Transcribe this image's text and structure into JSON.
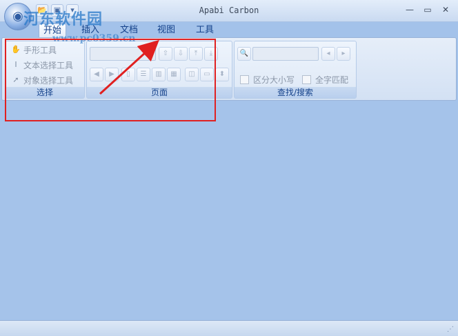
{
  "window": {
    "title": "Apabi Carbon",
    "orb_icon": "app-orb-icon",
    "qat": [
      {
        "icon": "folder-icon",
        "glyph": "📂"
      },
      {
        "icon": "save-icon",
        "glyph": "▣"
      },
      {
        "icon": "dropdown-icon",
        "glyph": "▾"
      }
    ],
    "controls": {
      "minimize": "—",
      "maximize": "▭",
      "close": "✕"
    }
  },
  "watermark": {
    "text": "河东软件园",
    "url": "www.pc0359.cn"
  },
  "tabs": [
    {
      "label": "开始",
      "active": true
    },
    {
      "label": "插入",
      "active": false
    },
    {
      "label": "文档",
      "active": false
    },
    {
      "label": "视图",
      "active": false
    },
    {
      "label": "工具",
      "active": false
    }
  ],
  "groups": {
    "select": {
      "label": "选择",
      "tools": [
        {
          "label": "手形工具",
          "icon": "hand-icon",
          "glyph": "✋"
        },
        {
          "label": "文本选择工具",
          "icon": "text-cursor-icon",
          "glyph": "I"
        },
        {
          "label": "对象选择工具",
          "icon": "pointer-icon",
          "glyph": "➚"
        }
      ]
    },
    "page": {
      "label": "页面",
      "nav_buttons": [
        {
          "icon": "arrow-up-icon",
          "glyph": "⇧"
        },
        {
          "icon": "arrow-down-icon",
          "glyph": "⇩"
        },
        {
          "icon": "first-page-icon",
          "glyph": "⤒"
        },
        {
          "icon": "last-page-icon",
          "glyph": "⤓"
        }
      ],
      "view_buttons": [
        {
          "icon": "back-icon",
          "glyph": "◀"
        },
        {
          "icon": "forward-icon",
          "glyph": "▶"
        },
        {
          "icon": "single-page-icon",
          "glyph": "▯"
        },
        {
          "icon": "continuous-page-icon",
          "glyph": "☰"
        },
        {
          "icon": "two-page-icon",
          "glyph": "▥"
        },
        {
          "icon": "two-continuous-icon",
          "glyph": "▦"
        },
        {
          "icon": "actual-size-icon",
          "glyph": "◫"
        },
        {
          "icon": "fit-page-icon",
          "glyph": "▭"
        },
        {
          "icon": "fit-width-icon",
          "glyph": "⬍"
        }
      ]
    },
    "search": {
      "label": "查找/搜索",
      "case_label": "区分大小写",
      "whole_word_label": "全字匹配",
      "find_icon": "find-icon",
      "prev_icon": "find-prev-icon",
      "next_icon": "find-next-icon"
    }
  },
  "status": {
    "text": ""
  },
  "colors": {
    "annotation": "#e02020",
    "workspace": "#a5c3ea"
  }
}
